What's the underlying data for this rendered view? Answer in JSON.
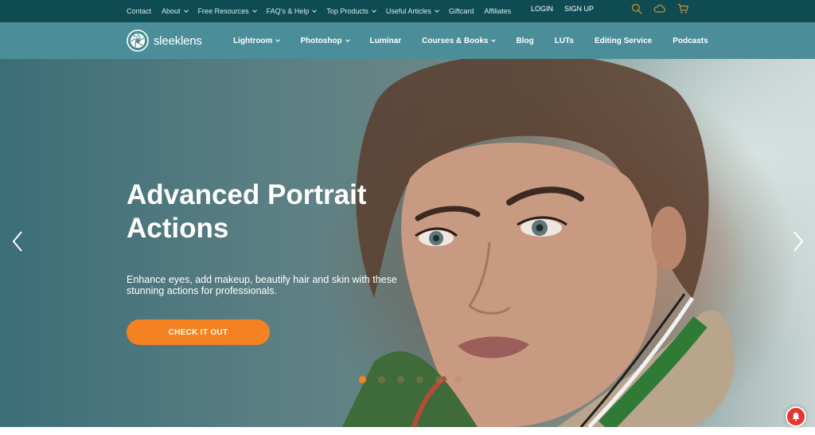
{
  "topbar": {
    "links": [
      {
        "label": "Contact",
        "has_dropdown": false
      },
      {
        "label": "About",
        "has_dropdown": true
      },
      {
        "label": "Free Resources",
        "has_dropdown": true
      },
      {
        "label": "FAQ's & Help",
        "has_dropdown": true
      },
      {
        "label": "Top Products",
        "has_dropdown": true
      },
      {
        "label": "Useful Articles",
        "has_dropdown": true
      },
      {
        "label": "Giftcard",
        "has_dropdown": false
      },
      {
        "label": "Affiliates",
        "has_dropdown": false
      }
    ],
    "login": "LOGIN",
    "signup": "SIGN UP",
    "icons": [
      "search-icon",
      "cloud-icon",
      "cart-icon"
    ],
    "accent_color": "#c8932e"
  },
  "nav": {
    "logo_text": "sleeklens",
    "items": [
      {
        "label": "Lightroom",
        "has_dropdown": true
      },
      {
        "label": "Photoshop",
        "has_dropdown": true
      },
      {
        "label": "Luminar",
        "has_dropdown": false
      },
      {
        "label": "Courses & Books",
        "has_dropdown": true
      },
      {
        "label": "Blog",
        "has_dropdown": false
      },
      {
        "label": "LUTs",
        "has_dropdown": false
      },
      {
        "label": "Editing Service",
        "has_dropdown": false
      },
      {
        "label": "Podcasts",
        "has_dropdown": false
      }
    ]
  },
  "hero": {
    "title": "Advanced Portrait Actions",
    "subtitle": "Enhance eyes, add makeup, beautify hair and skin with these stunning actions for professionals.",
    "cta_label": "CHECK IT OUT",
    "slide_count": 6,
    "active_slide": 1
  },
  "colors": {
    "topbar_bg": "#0f4b52",
    "nav_bg": "#4b8e99",
    "cta": "#f58220",
    "notification": "#e6362e"
  }
}
